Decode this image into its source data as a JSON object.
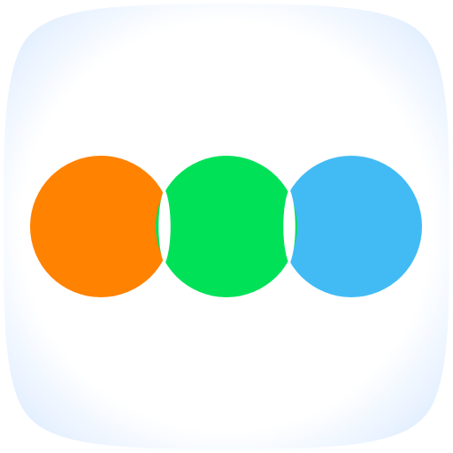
{
  "icon": {
    "name": "three-circles-app-icon",
    "background_color": "#ffffff",
    "glow_color": "#e3efff",
    "circles": [
      {
        "name": "orange-circle",
        "color": "#ff8200"
      },
      {
        "name": "green-circle",
        "color": "#00e158"
      },
      {
        "name": "blue-circle",
        "color": "#42bbf5"
      }
    ]
  }
}
